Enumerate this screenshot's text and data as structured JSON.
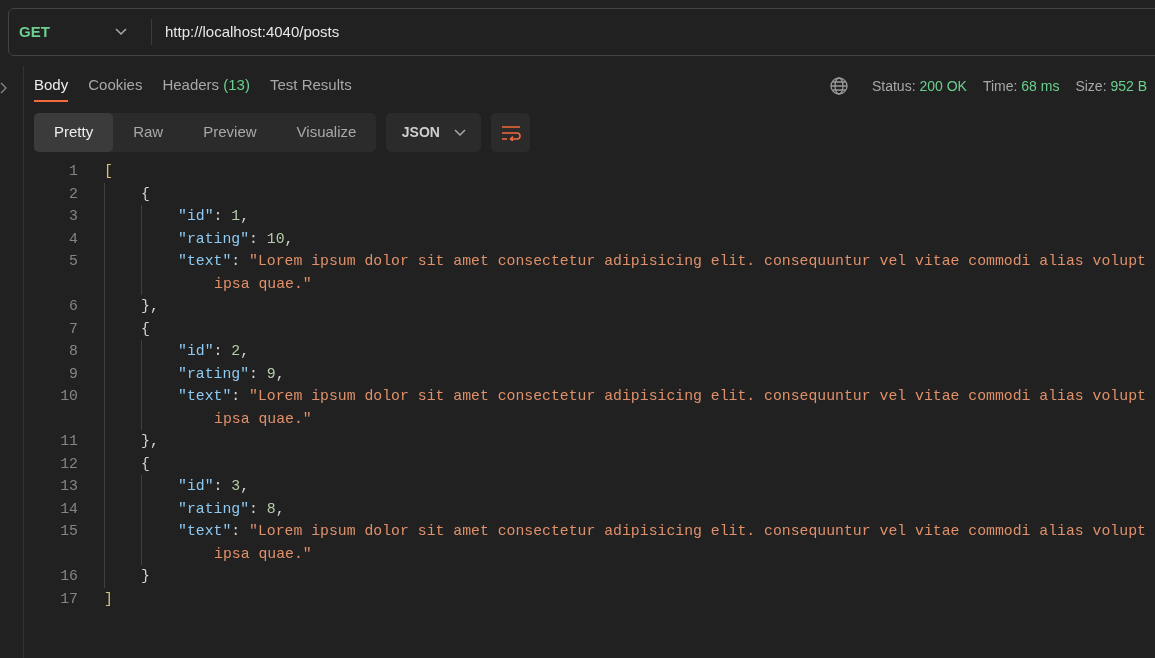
{
  "request": {
    "method": "GET",
    "url": "http://localhost:4040/posts"
  },
  "tabs": [
    {
      "label": "Body",
      "selected": true
    },
    {
      "label": "Cookies",
      "selected": false
    },
    {
      "label": "Headers",
      "count": "(13)",
      "selected": false
    },
    {
      "label": "Test Results",
      "selected": false
    }
  ],
  "status": [
    {
      "label": "Status:",
      "value": "200 OK"
    },
    {
      "label": "Time:",
      "value": "68 ms"
    },
    {
      "label": "Size:",
      "value": "952 B"
    }
  ],
  "view_modes": [
    {
      "label": "Pretty",
      "selected": true
    },
    {
      "label": "Raw",
      "selected": false
    },
    {
      "label": "Preview",
      "selected": false
    },
    {
      "label": "Visualize",
      "selected": false
    }
  ],
  "format": "JSON",
  "code": [
    {
      "number": "1",
      "tokens": [
        {
          "kind": "bracket",
          "text": "["
        }
      ],
      "children": [
        {
          "number": "2",
          "tokens": [
            {
              "kind": "punct",
              "text": "{"
            }
          ],
          "children": [
            {
              "number": "3",
              "tokens": [
                {
                  "kind": "key",
                  "text": "\"id\""
                },
                {
                  "kind": "punct",
                  "text": ": "
                },
                {
                  "kind": "number",
                  "text": "1"
                },
                {
                  "kind": "punct",
                  "text": ","
                }
              ]
            },
            {
              "number": "4",
              "tokens": [
                {
                  "kind": "key",
                  "text": "\"rating\""
                },
                {
                  "kind": "punct",
                  "text": ": "
                },
                {
                  "kind": "number",
                  "text": "10"
                },
                {
                  "kind": "punct",
                  "text": ","
                }
              ]
            },
            {
              "number": "5",
              "tokens": [
                {
                  "kind": "key",
                  "text": "\"text\""
                },
                {
                  "kind": "punct",
                  "text": ": "
                },
                {
                  "kind": "string",
                  "text": "\"Lorem ipsum dolor sit amet consectetur adipisicing elit. consequuntur vel vitae commodi alias volupt"
                }
              ],
              "continuation": "ipsa quae.\""
            }
          ]
        },
        {
          "number": "6",
          "tokens": [
            {
              "kind": "punct",
              "text": "},"
            }
          ]
        },
        {
          "number": "7",
          "tokens": [
            {
              "kind": "punct",
              "text": "{"
            }
          ],
          "children": [
            {
              "number": "8",
              "tokens": [
                {
                  "kind": "key",
                  "text": "\"id\""
                },
                {
                  "kind": "punct",
                  "text": ": "
                },
                {
                  "kind": "number",
                  "text": "2"
                },
                {
                  "kind": "punct",
                  "text": ","
                }
              ]
            },
            {
              "number": "9",
              "tokens": [
                {
                  "kind": "key",
                  "text": "\"rating\""
                },
                {
                  "kind": "punct",
                  "text": ": "
                },
                {
                  "kind": "number",
                  "text": "9"
                },
                {
                  "kind": "punct",
                  "text": ","
                }
              ]
            },
            {
              "number": "10",
              "tokens": [
                {
                  "kind": "key",
                  "text": "\"text\""
                },
                {
                  "kind": "punct",
                  "text": ": "
                },
                {
                  "kind": "string",
                  "text": "\"Lorem ipsum dolor sit amet consectetur adipisicing elit. consequuntur vel vitae commodi alias volupt"
                }
              ],
              "continuation": "ipsa quae.\""
            }
          ]
        },
        {
          "number": "11",
          "tokens": [
            {
              "kind": "punct",
              "text": "},"
            }
          ]
        },
        {
          "number": "12",
          "tokens": [
            {
              "kind": "punct",
              "text": "{"
            }
          ],
          "children": [
            {
              "number": "13",
              "tokens": [
                {
                  "kind": "key",
                  "text": "\"id\""
                },
                {
                  "kind": "punct",
                  "text": ": "
                },
                {
                  "kind": "number",
                  "text": "3"
                },
                {
                  "kind": "punct",
                  "text": ","
                }
              ]
            },
            {
              "number": "14",
              "tokens": [
                {
                  "kind": "key",
                  "text": "\"rating\""
                },
                {
                  "kind": "punct",
                  "text": ": "
                },
                {
                  "kind": "number",
                  "text": "8"
                },
                {
                  "kind": "punct",
                  "text": ","
                }
              ]
            },
            {
              "number": "15",
              "tokens": [
                {
                  "kind": "key",
                  "text": "\"text\""
                },
                {
                  "kind": "punct",
                  "text": ": "
                },
                {
                  "kind": "string",
                  "text": "\"Lorem ipsum dolor sit amet consectetur adipisicing elit. consequuntur vel vitae commodi alias volupt"
                }
              ],
              "continuation": "ipsa quae.\""
            }
          ]
        },
        {
          "number": "16",
          "tokens": [
            {
              "kind": "punct",
              "text": "}"
            }
          ]
        }
      ]
    },
    {
      "number": "17",
      "tokens": [
        {
          "kind": "bracket",
          "text": "]"
        }
      ]
    }
  ]
}
